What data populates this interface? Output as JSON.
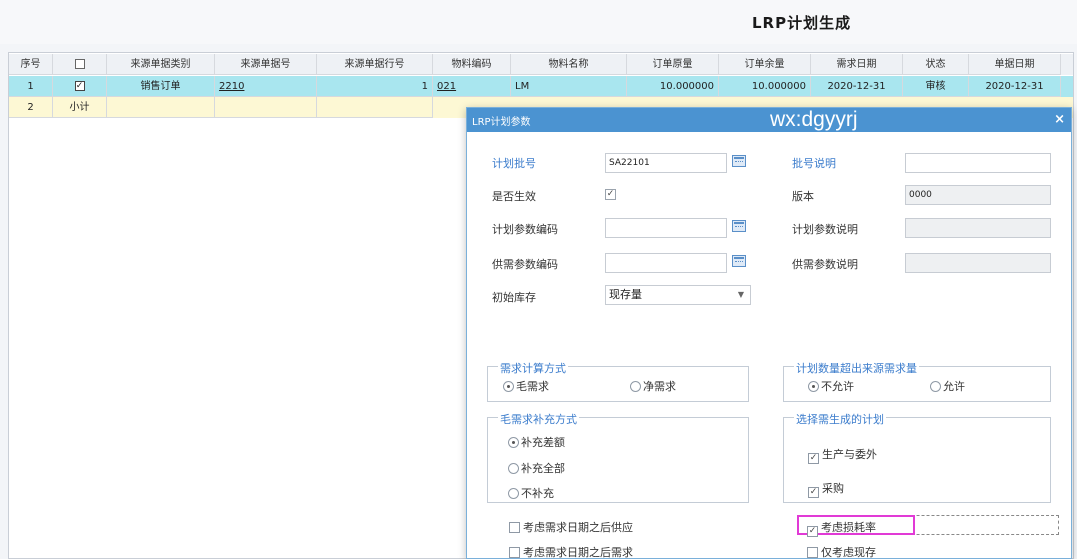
{
  "page": {
    "title": "LRP计划生成"
  },
  "table": {
    "headers": [
      "序号",
      "",
      "来源单据类别",
      "来源单据号",
      "来源单据行号",
      "物料编码",
      "物料名称",
      "订单原量",
      "订单余量",
      "需求日期",
      "状态",
      "单据日期"
    ],
    "row1": {
      "seq": "1",
      "checked": "✓",
      "source_type": "销售订单",
      "source_no": "2210",
      "line_no": "1",
      "material_code": "021",
      "material_name": "LM",
      "order_qty": "10.000000",
      "remain_qty": "10.000000",
      "need_date": "2020-12-31",
      "status": "审核",
      "doc_date": "2020-12-31"
    },
    "row2": {
      "seq": "2",
      "subtotal": "小计"
    }
  },
  "dialog": {
    "title": "LRP计划参数",
    "watermark": "wx:dgyyrj",
    "close": "×",
    "plan_batch_label": "计划批号",
    "plan_batch_value": "SA22101",
    "batch_desc_label": "批号说明",
    "batch_desc_value": "",
    "effective_label": "是否生效",
    "effective_check": "✓",
    "version_label": "版本",
    "version_value": "0000",
    "plan_param_code_label": "计划参数编码",
    "plan_param_desc_label": "计划参数说明",
    "supply_param_code_label": "供需参数编码",
    "supply_param_desc_label": "供需参数说明",
    "initial_stock_label": "初始库存",
    "initial_stock_value": "现存量",
    "demand_calc": {
      "legend": "需求计算方式",
      "opt1": "毛需求",
      "opt2": "净需求"
    },
    "plan_exceed": {
      "legend": "计划数量超出来源需求量",
      "opt1": "不允许",
      "opt2": "允许"
    },
    "gross_supplement": {
      "legend": "毛需求补充方式",
      "opt1": "补充差额",
      "opt2": "补充全部",
      "opt3": "不补充"
    },
    "gen_plan": {
      "legend": "选择需生成的计划",
      "opt1": "生产与委外",
      "opt2": "采购",
      "check": "✓"
    },
    "consider_after_date": "考虑需求日期之后供应",
    "consider_before_date": "考虑需求日期之后需求",
    "consider_loss": "考虑损耗率",
    "only_stock": "仅考虑现存"
  }
}
